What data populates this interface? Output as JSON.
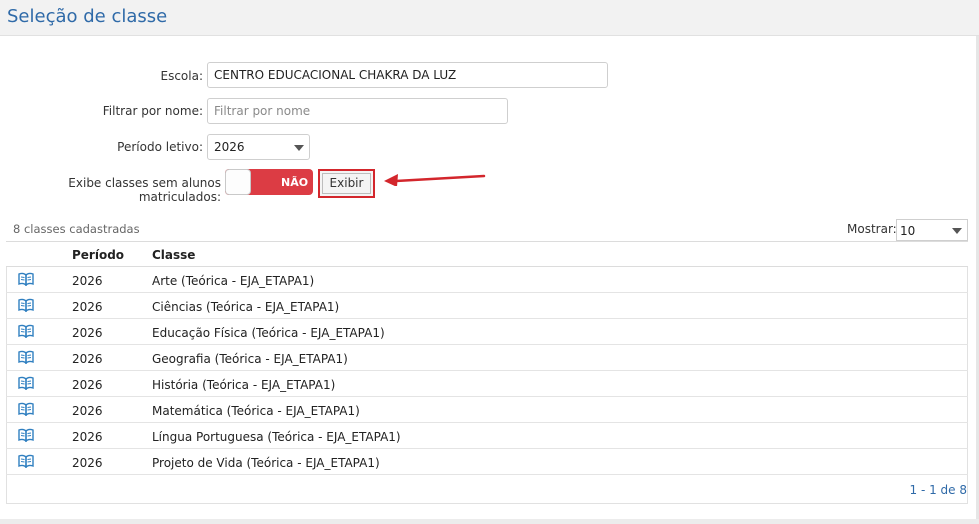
{
  "page": {
    "title": "Seleção de classe"
  },
  "form": {
    "escola_label": "Escola:",
    "escola_value": "CENTRO EDUCACIONAL CHAKRA DA LUZ",
    "filtro_label": "Filtrar por nome:",
    "filtro_placeholder": "Filtrar por nome",
    "periodo_label": "Período letivo:",
    "periodo_value": "2026",
    "exibe_label": "Exibe classes sem alunos matriculados:",
    "toggle_label": "NÃO",
    "exibir_button": "Exibir"
  },
  "list": {
    "count_text": "8 classes cadastradas",
    "mostrar_label": "Mostrar:",
    "mostrar_value": "10",
    "columns": {
      "periodo": "Período",
      "classe": "Classe"
    },
    "rows": [
      {
        "periodo": "2026",
        "classe": "Arte (Teórica - EJA_ETAPA1)"
      },
      {
        "periodo": "2026",
        "classe": "Ciências (Teórica - EJA_ETAPA1)"
      },
      {
        "periodo": "2026",
        "classe": "Educação Física (Teórica - EJA_ETAPA1)"
      },
      {
        "periodo": "2026",
        "classe": "Geografia (Teórica - EJA_ETAPA1)"
      },
      {
        "periodo": "2026",
        "classe": "História (Teórica - EJA_ETAPA1)"
      },
      {
        "periodo": "2026",
        "classe": "Matemática (Teórica - EJA_ETAPA1)"
      },
      {
        "periodo": "2026",
        "classe": "Língua Portuguesa (Teórica - EJA_ETAPA1)"
      },
      {
        "periodo": "2026",
        "classe": "Projeto de Vida (Teórica - EJA_ETAPA1)"
      }
    ],
    "row_icon": "open-book-icon",
    "pager_text": "1 - 1 de 8"
  },
  "colors": {
    "title": "#2f6aa8",
    "toggle_off": "#dc3c44",
    "highlight": "#d3262c",
    "icon": "#2f7fc0"
  }
}
